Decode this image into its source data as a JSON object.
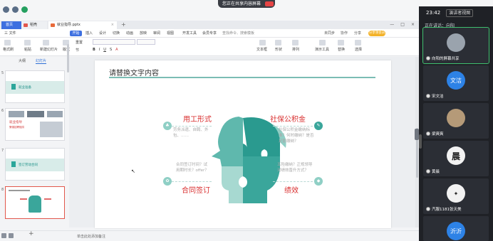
{
  "os": {
    "share_text": "您正在共享内容屏幕"
  },
  "tabs": {
    "home": "首页",
    "wps": "稻壳",
    "doc": "就业指导.pptx"
  },
  "menu": {
    "file": "三 文件",
    "start": "开始",
    "items": [
      "插入",
      "设计",
      "切换",
      "动画",
      "放映",
      "审阅",
      "视图",
      "开发工具",
      "会员专享"
    ],
    "search": "查找命令、搜索模板",
    "right": [
      "未同步",
      "协作",
      "分享"
    ],
    "badge": "分享领会员"
  },
  "ribbon": {
    "items": [
      "格式刷",
      "粘贴",
      "新建幻灯片",
      "版式",
      "重置",
      "节",
      "文本框",
      "形状",
      "排列",
      "演示工具",
      "替换",
      "选择"
    ]
  },
  "panel": {
    "tab_outline": "大纲",
    "tab_slides": "幻灯片"
  },
  "thumbs": [
    {
      "num": "5",
      "title": "就业准备"
    },
    {
      "num": "6",
      "title": "就业指导",
      "red": "警惕招聘陷阱"
    },
    {
      "num": "7",
      "title": "签订劳动合同"
    },
    {
      "num": "8",
      "title": ""
    }
  ],
  "notes": "单击此处添加备注",
  "slide": {
    "title": "请替换文字内容",
    "labels": {
      "top_left": "用工形式",
      "top_right": "社保公积金",
      "bottom_left": "合同签订",
      "bottom_right": "绩效"
    },
    "texts": {
      "top_left": "劳务派遣、自聘、外包、……",
      "top_right": "社保公积金缴纳标准？何时缴纳？是否足额缴纳？",
      "bottom_left": "合同签订时间？试用期时长？offer？",
      "bottom_right": "五险缴纳？正规领导对绩效晋升方式？"
    }
  },
  "meeting": {
    "time": "23:42",
    "view_btn": "演讲者视图",
    "speaking": "正在讲话：向阳",
    "participants": [
      {
        "name": "向阳的屏幕共享",
        "avatar": ""
      },
      {
        "name": "宋文洁",
        "avatar": "文洁"
      },
      {
        "name": "梁爽爽",
        "avatar": ""
      },
      {
        "name": "黄晨",
        "avatar": "晨"
      },
      {
        "name": "汽服1181张天美",
        "avatar": ""
      },
      {
        "name": "",
        "avatar": "沂沂"
      }
    ]
  }
}
